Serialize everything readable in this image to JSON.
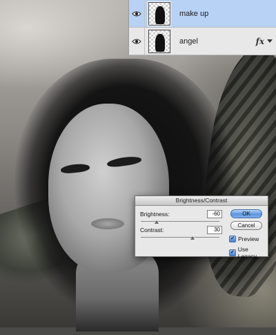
{
  "layers_panel": {
    "layers": [
      {
        "name": "make up",
        "selected": true,
        "visible": true,
        "has_fx": false,
        "eye_icon": "eye-icon"
      },
      {
        "name": "angel",
        "selected": false,
        "visible": true,
        "has_fx": true,
        "fx_label": "fx",
        "eye_icon": "eye-icon"
      }
    ]
  },
  "dialog": {
    "title": "Brightness/Contrast",
    "brightness_label": "Brightness:",
    "brightness_value": "-60",
    "contrast_label": "Contrast:",
    "contrast_value": "30",
    "ok_label": "OK",
    "cancel_label": "Cancel",
    "preview_label": "Preview",
    "preview_checked": true,
    "use_legacy_label": "Use Legacy",
    "use_legacy_checked": true,
    "check_glyph": "✔"
  },
  "colors": {
    "selected_layer": "#b7d2f5",
    "default_button": "#5b95de"
  }
}
